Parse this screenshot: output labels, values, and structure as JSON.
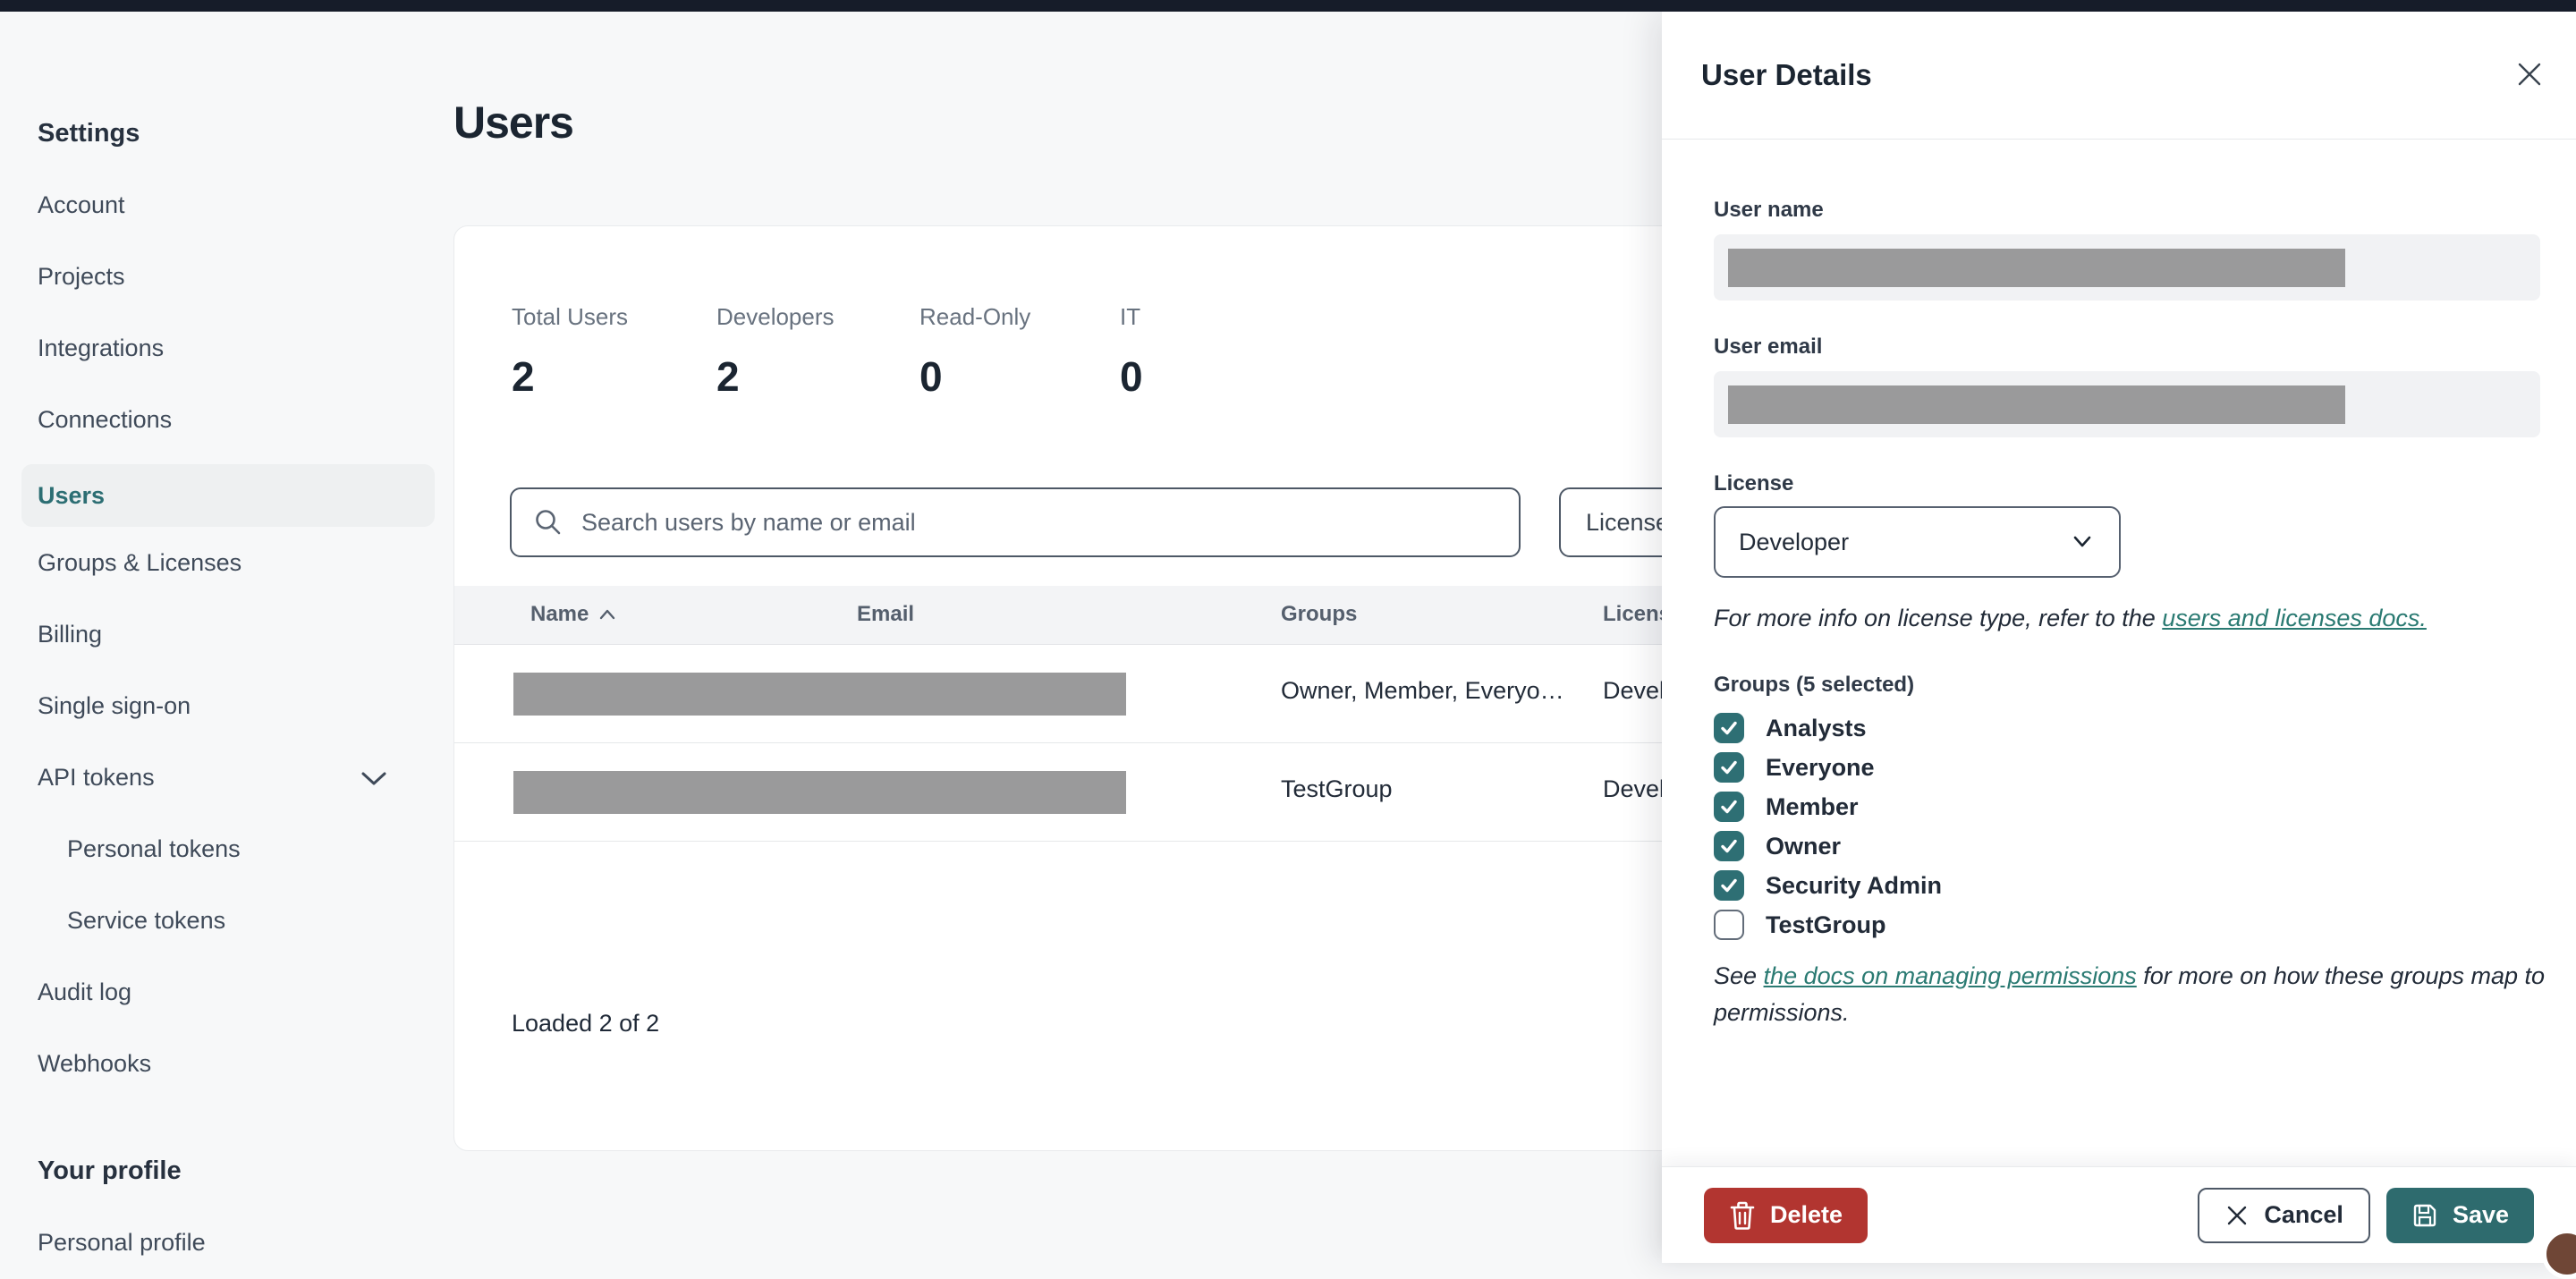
{
  "colors": {
    "topbar": "#161c29",
    "accent_teal": "#2c6e73",
    "link_teal": "#2a7a72",
    "checkbox_teal": "#2e6f74",
    "delete_red": "#b23530",
    "save_teal": "#2e6b6e",
    "redaction_gray": "#9a9a9b"
  },
  "sidebar": {
    "section_settings": "Settings",
    "items": [
      {
        "label": "Account",
        "active": false
      },
      {
        "label": "Projects",
        "active": false
      },
      {
        "label": "Integrations",
        "active": false
      },
      {
        "label": "Connections",
        "active": false
      },
      {
        "label": "Users",
        "active": true
      },
      {
        "label": "Groups & Licenses",
        "active": false
      },
      {
        "label": "Billing",
        "active": false
      },
      {
        "label": "Single sign-on",
        "active": false
      },
      {
        "label": "API tokens",
        "active": false,
        "expandable": true
      },
      {
        "label": "Personal tokens",
        "active": false,
        "sub": true
      },
      {
        "label": "Service tokens",
        "active": false,
        "sub": true
      },
      {
        "label": "Audit log",
        "active": false
      },
      {
        "label": "Webhooks",
        "active": false
      }
    ],
    "section_profile": "Your profile",
    "profile_items": [
      {
        "label": "Personal profile"
      }
    ]
  },
  "main": {
    "title": "Users",
    "stats": [
      {
        "label": "Total Users",
        "value": "2"
      },
      {
        "label": "Developers",
        "value": "2"
      },
      {
        "label": "Read-Only",
        "value": "0"
      },
      {
        "label": "IT",
        "value": "0"
      }
    ],
    "search_placeholder": "Search users by name or email",
    "license_filter_label": "License",
    "table": {
      "headers": {
        "name": "Name",
        "email": "Email",
        "groups": "Groups",
        "license": "License"
      },
      "rows": [
        {
          "groups": "Owner, Member, Everyo…",
          "license": "Developer"
        },
        {
          "groups": "TestGroup",
          "license": "Developer"
        }
      ]
    },
    "loaded_text": "Loaded 2 of 2"
  },
  "drawer": {
    "title": "User Details",
    "user_name_label": "User name",
    "user_email_label": "User email",
    "license_label": "License",
    "license_value": "Developer",
    "license_note_prefix": "For more info on license type, refer to the ",
    "license_note_link": "users and licenses docs.",
    "groups_label": "Groups (5 selected)",
    "groups": [
      {
        "name": "Analysts",
        "checked": true
      },
      {
        "name": "Everyone",
        "checked": true
      },
      {
        "name": "Member",
        "checked": true
      },
      {
        "name": "Owner",
        "checked": true
      },
      {
        "name": "Security Admin",
        "checked": true
      },
      {
        "name": "TestGroup",
        "checked": false
      }
    ],
    "perms_note_prefix": "See ",
    "perms_note_link": "the docs on managing permissions",
    "perms_note_suffix": " for more on how these groups map to permissions.",
    "buttons": {
      "delete": "Delete",
      "cancel": "Cancel",
      "save": "Save"
    }
  }
}
